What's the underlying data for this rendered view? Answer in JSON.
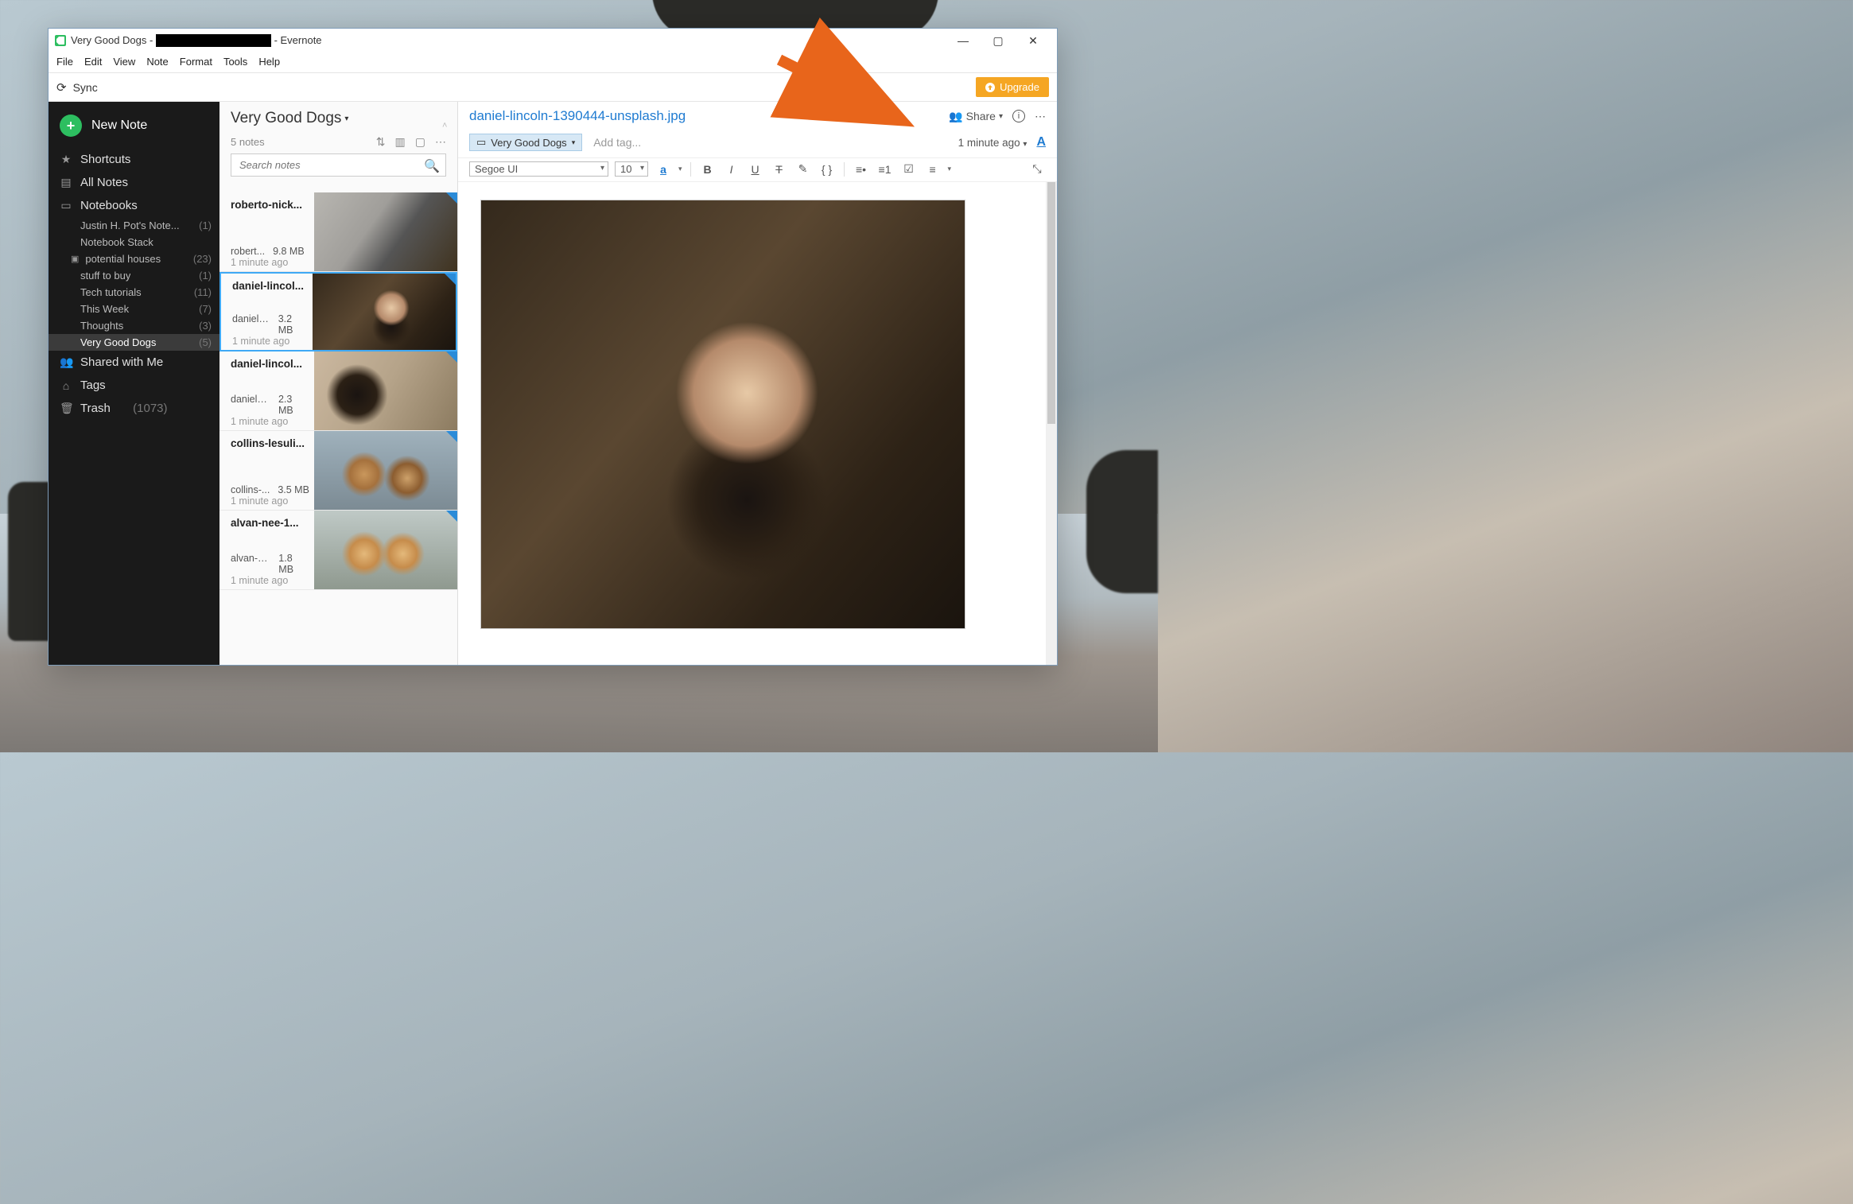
{
  "window": {
    "title_prefix": "Very Good Dogs - ",
    "title_suffix": " - Evernote"
  },
  "menubar": [
    "File",
    "Edit",
    "View",
    "Note",
    "Format",
    "Tools",
    "Help"
  ],
  "syncbar": {
    "sync_label": "Sync",
    "upgrade_label": "Upgrade"
  },
  "sidebar": {
    "new_note": "New Note",
    "shortcuts": "Shortcuts",
    "all_notes": "All Notes",
    "notebooks_label": "Notebooks",
    "notebooks": [
      {
        "label": "Justin H. Pot's Note...",
        "count": "(1)"
      },
      {
        "label": "Notebook Stack",
        "count": ""
      },
      {
        "label": "potential houses",
        "count": "(23)",
        "icon": true
      },
      {
        "label": "stuff to buy",
        "count": "(1)"
      },
      {
        "label": "Tech tutorials",
        "count": "(11)"
      },
      {
        "label": "This Week",
        "count": "(7)"
      },
      {
        "label": "Thoughts",
        "count": "(3)"
      },
      {
        "label": "Very Good Dogs",
        "count": "(5)",
        "selected": true
      }
    ],
    "shared": "Shared with Me",
    "tags": "Tags",
    "trash": "Trash",
    "trash_count": "(1073)"
  },
  "notelist": {
    "title": "Very Good Dogs",
    "count": "5 notes",
    "search_placeholder": "Search notes",
    "notes": [
      {
        "title": "roberto-nick...",
        "file": "robert...",
        "size": "9.8 MB",
        "ago": "1 minute ago",
        "thumb": "th1"
      },
      {
        "title": "daniel-lincol...",
        "file": "daniel-l...",
        "size": "3.2 MB",
        "ago": "1 minute ago",
        "thumb": "th2",
        "selected": true
      },
      {
        "title": "daniel-lincol...",
        "file": "daniel-l...",
        "size": "2.3 MB",
        "ago": "1 minute ago",
        "thumb": "th3"
      },
      {
        "title": "collins-lesuli...",
        "file": "collins-...",
        "size": "3.5 MB",
        "ago": "1 minute ago",
        "thumb": "th4"
      },
      {
        "title": "alvan-nee-1...",
        "file": "alvan-n...",
        "size": "1.8 MB",
        "ago": "1 minute ago",
        "thumb": "th5"
      }
    ]
  },
  "note": {
    "title": "daniel-lincoln-1390444-unsplash.jpg",
    "share_label": "Share",
    "notebook": "Very Good Dogs",
    "add_tag": "Add tag...",
    "ago": "1 minute ago",
    "font_name": "Segoe UI",
    "font_size": "10"
  }
}
